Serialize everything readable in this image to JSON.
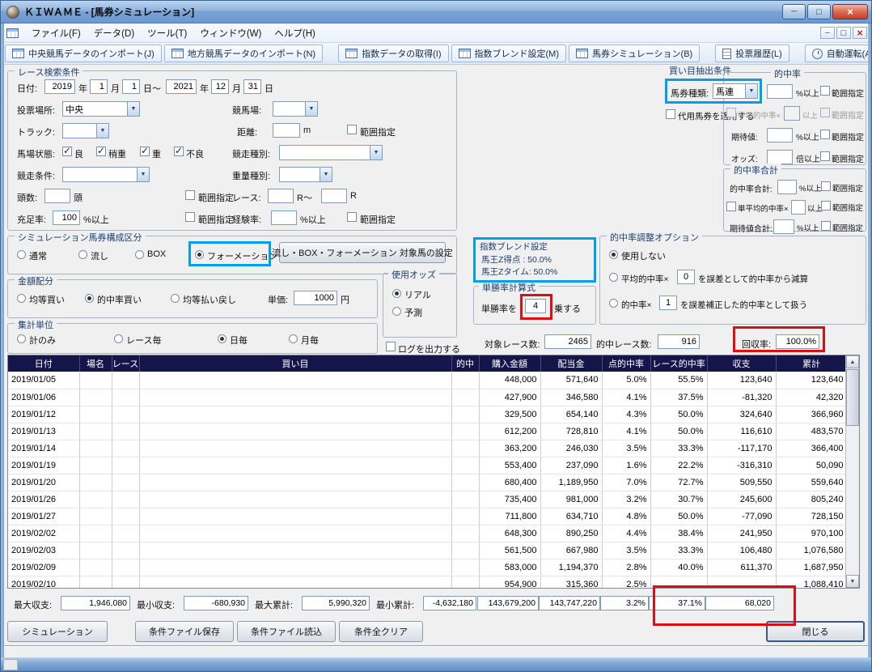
{
  "window": {
    "title": "ＫＩＷＡＭＥ - [馬券シミュレーション]"
  },
  "menu": {
    "items": [
      "ファイル(F)",
      "データ(D)",
      "ツール(T)",
      "ウィンドウ(W)",
      "ヘルプ(H)"
    ]
  },
  "toolbar": {
    "buttons": [
      "中央競馬データのインポート(J)",
      "地方競馬データのインポート(N)",
      "指数データの取得(I)",
      "指数ブレンド設定(M)",
      "馬券シミュレーション(B)",
      "投票履歴(L)",
      "自動運転(A)"
    ]
  },
  "shared": {
    "range": "範囲指定"
  },
  "search": {
    "title": "レース検索条件",
    "date_label": "日付:",
    "from_year": "2019",
    "from_month": "1",
    "from_day": "1",
    "to_year": "2021",
    "to_month": "12",
    "to_day": "31",
    "unit_year": "年",
    "unit_month": "月",
    "unit_day": "日",
    "unit_day_tilde": "日～",
    "place_label": "投票場所:",
    "place_value": "中央",
    "course_label": "競馬場:",
    "track_label": "トラック:",
    "distance_label": "距離:",
    "distance_unit": "m",
    "surface_label": "馬場状態:",
    "surface_options": [
      "良",
      "稍重",
      "重",
      "不良"
    ],
    "race_type_label": "競走種別:",
    "race_cond_label": "競走条件:",
    "weight_label": "重量種別:",
    "heads_label": "頭数:",
    "heads_unit": "頭",
    "race_no_label": "レース:",
    "race_no_mid": "R～",
    "race_no_end": "R",
    "fill_label": "充足率:",
    "fill_value": "100",
    "fill_unit": "%以上",
    "exp_label": "経験率:",
    "exp_unit": "%以上"
  },
  "extract": {
    "title": "買い目抽出条件",
    "ticket_label": "馬券種類:",
    "ticket_value": "馬連",
    "substitute_label": "代用馬券を適用する",
    "hit": {
      "title": "的中率",
      "r1_label": "的中率:",
      "r1_unit": "%以上",
      "r2_label": "平均的中率×",
      "r2_unit": "以上",
      "r3_label": "期待値:",
      "r3_unit": "%以上",
      "r4_label": "オッズ:",
      "r4_unit": "倍以上"
    },
    "hitsum": {
      "title": "的中率合計",
      "r1_label": "的中率合計:",
      "r1_unit": "%以上",
      "r2_label": "単平均的中率×",
      "r2_unit": "以上",
      "r3_label": "期待値合計:",
      "r3_un": "",
      "r3_unit": "%以上"
    }
  },
  "composition": {
    "title": "シミュレーション馬券構成区分",
    "options": [
      "通常",
      "流し",
      "BOX",
      "フォーメーション"
    ],
    "target_button": "流し・BOX・フォーメーション 対象馬の設定"
  },
  "amount": {
    "title": "金額配分",
    "options": [
      "均等買い",
      "的中率買い",
      "均等払い戻し"
    ],
    "unit_label": "単価:",
    "unit_value": "1000",
    "unit_suffix": "円"
  },
  "odds": {
    "title": "使用オッズ",
    "options": [
      "リアル",
      "予測"
    ]
  },
  "aggregate": {
    "title": "集計単位",
    "options": [
      "計のみ",
      "レース毎",
      "日毎",
      "月毎"
    ]
  },
  "log_label": "ログを出力する",
  "blend": {
    "title": "指数ブレンド設定",
    "line1": "馬王Z得点 : 50.0%",
    "line2": "馬王Zタイム: 50.0%"
  },
  "win_formula": {
    "title": "単勝率計算式",
    "prefix": "単勝率を",
    "value": "4",
    "suffix": "乗する"
  },
  "adjust": {
    "title": "的中率調整オプション",
    "opt1": "使用しない",
    "opt2_prefix": "平均的中率×",
    "opt2_value": "0",
    "opt2_suffix": "を誤差として的中率から減算",
    "opt3_prefix": "的中率×",
    "opt3_value": "1",
    "opt3_suffix": "を誤差補正した的中率として扱う"
  },
  "stats": {
    "races_label": "対象レース数:",
    "races_value": "2465",
    "hits_label": "的中レース数:",
    "hits_value": "916",
    "payback_label": "回収率:",
    "payback_value": "100.0%"
  },
  "table": {
    "columns": [
      "日付",
      "場名",
      "レース",
      "買い目",
      "的中",
      "購入金額",
      "配当金",
      "点的中率",
      "レース的中率",
      "収支",
      "累計"
    ],
    "rows": [
      [
        "2019/01/05",
        "",
        "",
        "",
        "",
        "448,000",
        "571,640",
        "5.0%",
        "55.5%",
        "123,640",
        "123,640"
      ],
      [
        "2019/01/06",
        "",
        "",
        "",
        "",
        "427,900",
        "346,580",
        "4.1%",
        "37.5%",
        "-81,320",
        "42,320"
      ],
      [
        "2019/01/12",
        "",
        "",
        "",
        "",
        "329,500",
        "654,140",
        "4.3%",
        "50.0%",
        "324,640",
        "366,960"
      ],
      [
        "2019/01/13",
        "",
        "",
        "",
        "",
        "612,200",
        "728,810",
        "4.1%",
        "50.0%",
        "116,610",
        "483,570"
      ],
      [
        "2019/01/14",
        "",
        "",
        "",
        "",
        "363,200",
        "246,030",
        "3.5%",
        "33.3%",
        "-117,170",
        "366,400"
      ],
      [
        "2019/01/19",
        "",
        "",
        "",
        "",
        "553,400",
        "237,090",
        "1.6%",
        "22.2%",
        "-316,310",
        "50,090"
      ],
      [
        "2019/01/20",
        "",
        "",
        "",
        "",
        "680,400",
        "1,189,950",
        "7.0%",
        "72.7%",
        "509,550",
        "559,640"
      ],
      [
        "2019/01/26",
        "",
        "",
        "",
        "",
        "735,400",
        "981,000",
        "3.2%",
        "30.7%",
        "245,600",
        "805,240"
      ],
      [
        "2019/01/27",
        "",
        "",
        "",
        "",
        "711,800",
        "634,710",
        "4.8%",
        "50.0%",
        "-77,090",
        "728,150"
      ],
      [
        "2019/02/02",
        "",
        "",
        "",
        "",
        "648,300",
        "890,250",
        "4.4%",
        "38.4%",
        "241,950",
        "970,100"
      ],
      [
        "2019/02/03",
        "",
        "",
        "",
        "",
        "561,500",
        "667,980",
        "3.5%",
        "33.3%",
        "106,480",
        "1,076,580"
      ],
      [
        "2019/02/09",
        "",
        "",
        "",
        "",
        "583,000",
        "1,194,370",
        "2.8%",
        "40.0%",
        "611,370",
        "1,687,950"
      ],
      [
        "2019/02/10",
        "",
        "",
        "",
        "",
        "954,900",
        "315,360",
        "2.5%",
        "",
        "",
        "1,088,410"
      ]
    ]
  },
  "summary": {
    "labels": [
      "最大収支:",
      "最小収支:",
      "最大累計:",
      "最小累計:"
    ],
    "values": [
      "1,946,080",
      "-680,930",
      "5,990,320",
      "-4,632,180"
    ],
    "totals": [
      "143,679,200",
      "143,747,220",
      "3.2%",
      "37.1%",
      "68,020"
    ]
  },
  "footer": {
    "buttons": [
      "シミュレーション",
      "条件ファイル保存",
      "条件ファイル読込",
      "条件全クリア"
    ],
    "close": "閉じる"
  },
  "colors": {
    "annotation_red": "#dc1010",
    "annotation_blue": "#00a0e6",
    "table_header_bg": "#15154b",
    "title_text": "#0a0a0a"
  }
}
